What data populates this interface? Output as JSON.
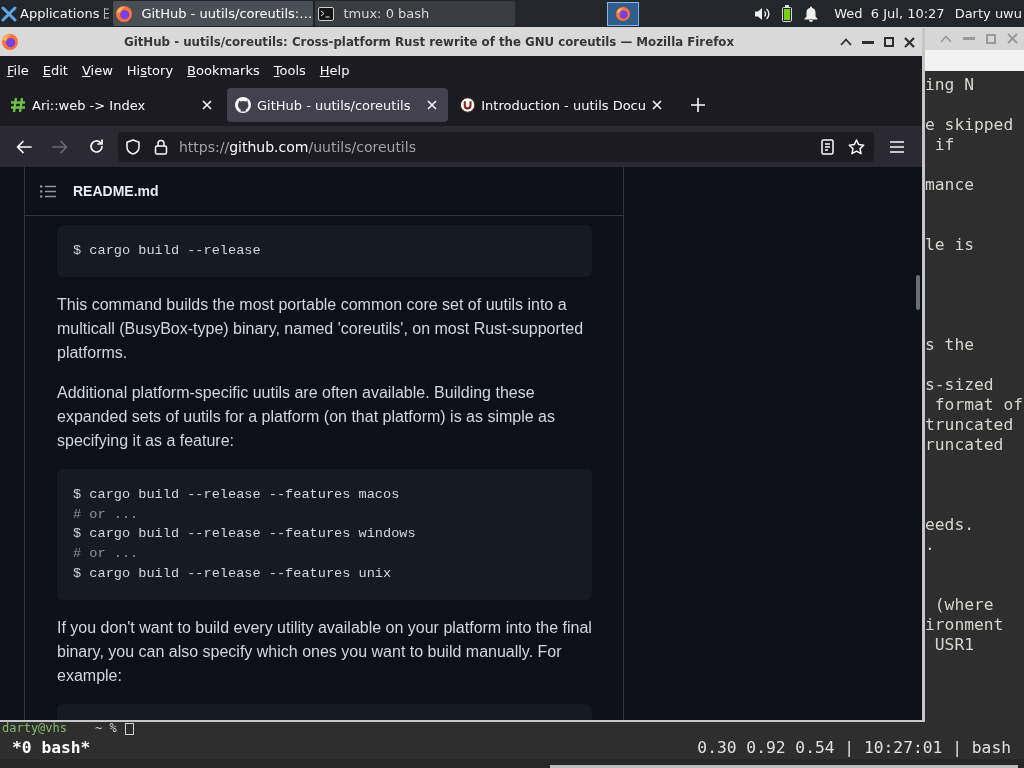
{
  "taskbar": {
    "menu_label": "Applications",
    "tasks": [
      {
        "kind": "browser",
        "title": "GitHub - uutils/coreutils:…",
        "selected": true
      },
      {
        "kind": "terminal",
        "title": "tmux: 0 bash",
        "selected": false
      }
    ],
    "clock": "Wed  6 Jul, 10:27",
    "user": "Darty uwu"
  },
  "terminal": {
    "rows": [
      {
        "kind": "text",
        "text": "ing N"
      },
      {
        "kind": "blank"
      },
      {
        "kind": "text",
        "text": "e skipped"
      },
      {
        "kind": "text",
        "text": " if"
      },
      {
        "kind": "blank"
      },
      {
        "kind": "text",
        "text": "mance"
      },
      {
        "kind": "blank"
      },
      {
        "kind": "blank"
      },
      {
        "kind": "text",
        "text": "le is"
      },
      {
        "kind": "blank"
      },
      {
        "kind": "blank"
      },
      {
        "kind": "blank"
      },
      {
        "kind": "blank"
      },
      {
        "kind": "text",
        "text": "s the"
      },
      {
        "kind": "blank"
      },
      {
        "kind": "text",
        "text": "s-sized"
      },
      {
        "kind": "text",
        "text": " format of"
      },
      {
        "kind": "text",
        "text": "truncated"
      },
      {
        "kind": "text",
        "text": "runcated"
      },
      {
        "kind": "blank"
      },
      {
        "kind": "blank"
      },
      {
        "kind": "blank"
      },
      {
        "kind": "text",
        "text": "eeds."
      },
      {
        "kind": "text",
        "text": "."
      },
      {
        "kind": "blank"
      },
      {
        "kind": "blank"
      },
      {
        "kind": "text",
        "text": " (where"
      },
      {
        "kind": "text",
        "text": "ironment"
      },
      {
        "kind": "text",
        "text": " USR1"
      }
    ],
    "prompt": {
      "host": "darty@vhs",
      "path": "~ %"
    },
    "status_left": "*0 bash*",
    "status_right": "0.30 0.92 0.54 | 10:27:01 | bash"
  },
  "browser": {
    "title": "GitHub - uutils/coreutils: Cross-platform Rust rewrite of the GNU coreutils — Mozilla Firefox",
    "menu": [
      {
        "key": "F",
        "rest": "ile"
      },
      {
        "key": "E",
        "rest": "dit"
      },
      {
        "key": "V",
        "rest": "iew"
      },
      {
        "start": "Hi",
        "key": "s",
        "rest": "tory"
      },
      {
        "key": "B",
        "rest": "ookmarks"
      },
      {
        "key": "T",
        "rest": "ools"
      },
      {
        "key": "H",
        "rest": "elp"
      }
    ],
    "tabs": [
      {
        "kind": "hash",
        "title": "Ari::web -> Index",
        "selected": false
      },
      {
        "kind": "github",
        "title": "GitHub - uutils/coreutils",
        "selected": true
      },
      {
        "kind": "docs",
        "title": "Introduction - uutils Docu",
        "selected": false
      }
    ],
    "nav": [
      {
        "kind": "back",
        "disabled": false
      },
      {
        "kind": "forward",
        "disabled": true
      },
      {
        "kind": "reload",
        "disabled": false
      }
    ],
    "url": {
      "scheme": "https://",
      "host": "github.com",
      "path": "/uutils/coreutils"
    },
    "readme": {
      "title": "README.md",
      "blocks": [
        {
          "kind": "code",
          "lines": [
            {
              "text": "$ cargo build --release",
              "comment": false
            }
          ]
        },
        {
          "kind": "paragraph",
          "text": "This command builds the most portable common core set of uutils into a multicall (BusyBox-type) binary, named 'coreutils', on most Rust-supported platforms."
        },
        {
          "kind": "paragraph",
          "text": "Additional platform-specific uutils are often available. Building these expanded sets of uutils for a platform (on that platform) is as simple as specifying it as a feature:"
        },
        {
          "kind": "code",
          "lines": [
            {
              "text": "$ cargo build --release --features macos",
              "comment": false
            },
            {
              "text": "# or ...",
              "comment": true
            },
            {
              "text": "$ cargo build --release --features windows",
              "comment": false
            },
            {
              "text": "# or ...",
              "comment": true
            },
            {
              "text": "$ cargo build --release --features unix",
              "comment": false
            }
          ]
        },
        {
          "kind": "paragraph",
          "text": "If you don't want to build every utility available on your platform into the final binary, you can also specify which ones you want to build manually. For example:"
        },
        {
          "kind": "code"
        }
      ]
    }
  }
}
